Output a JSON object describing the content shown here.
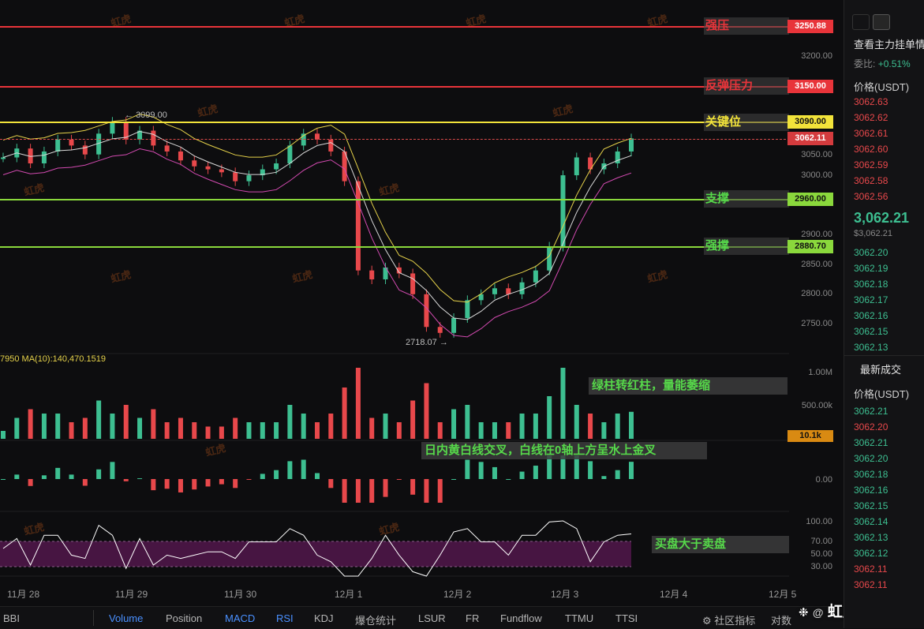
{
  "levels": [
    {
      "label": "强压",
      "price_text": "3250.88",
      "price": 3250.88,
      "color": "#e8343a",
      "text_color": "#e8343a"
    },
    {
      "label": "反弹压力",
      "price_text": "3150.00",
      "price": 3150.0,
      "color": "#e8343a",
      "text_color": "#e8343a"
    },
    {
      "label": "关键位",
      "price_text": "3090.00",
      "price": 3090.0,
      "color": "#f2e33a",
      "text_color": "#f2e33a"
    },
    {
      "label": "支撑",
      "price_text": "2960.00",
      "price": 2960.0,
      "color": "#8ad83c",
      "text_color": "#56d84a"
    },
    {
      "label": "强撑",
      "price_text": "2880.70",
      "price": 2880.7,
      "color": "#8ad83c",
      "text_color": "#56d84a"
    }
  ],
  "current_price_tag": "3062.11",
  "price_axis": [
    "3200.00",
    "3050.00",
    "3000.00",
    "2900.00",
    "2850.00",
    "2800.00",
    "2750.00"
  ],
  "high_marker": "3099.00",
  "low_marker": "2718.07",
  "volume_indicator_text": "7950  MA(10):140,470.1519",
  "volume_axis": [
    "1.00M",
    "500.00k"
  ],
  "volume_tag": "10.1k",
  "macd_axis": "0.00",
  "rsi_axis": [
    "100.00",
    "70.00",
    "50.00",
    "30.00"
  ],
  "annotations": {
    "volume": "绿柱转红柱，量能萎缩",
    "macd": "日内黄白线交叉，白线在0轴上方呈水上金叉",
    "rsi": "买盘大于卖盘"
  },
  "dates": [
    "11月 28",
    "11月 29",
    "11月 30",
    "12月 1",
    "12月 2",
    "12月 3",
    "12月 4",
    "12月 5"
  ],
  "watermark": "虹虎",
  "tabs": {
    "left": "BBI",
    "items": [
      "Volume",
      "Position",
      "MACD",
      "RSI",
      "KDJ",
      "爆仓统计",
      "LSUR",
      "FR",
      "Fundflow",
      "TTMU",
      "TTSI"
    ],
    "active": [
      "Volume",
      "MACD",
      "RSI"
    ],
    "community": "社区指标",
    "compare": "对数",
    "brand": "虹虎趋势"
  },
  "side": {
    "header": "查看主力挂单情",
    "ratio_label": "委比:",
    "ratio_value": "+0.51%",
    "price_header": "价格(USDT)",
    "asks": [
      "3062.63",
      "3062.62",
      "3062.61",
      "3062.60",
      "3062.59",
      "3062.58",
      "3062.56"
    ],
    "last_price": "3,062.21",
    "last_usd": "$3,062.21",
    "bids": [
      "3062.20",
      "3062.19",
      "3062.18",
      "3062.17",
      "3062.16",
      "3062.15",
      "3062.13"
    ],
    "trades_title": "最新成交",
    "trades_header": "价格(USDT)",
    "trades": [
      {
        "p": "3062.21",
        "c": "green"
      },
      {
        "p": "3062.20",
        "c": "red"
      },
      {
        "p": "3062.21",
        "c": "green"
      },
      {
        "p": "3062.20",
        "c": "green"
      },
      {
        "p": "3062.18",
        "c": "green"
      },
      {
        "p": "3062.16",
        "c": "green"
      },
      {
        "p": "3062.15",
        "c": "green"
      },
      {
        "p": "3062.14",
        "c": "green"
      },
      {
        "p": "3062.13",
        "c": "green"
      },
      {
        "p": "3062.12",
        "c": "green"
      },
      {
        "p": "3062.11",
        "c": "red"
      },
      {
        "p": "3062.11",
        "c": "red"
      }
    ]
  },
  "colors": {
    "up": "#3dbf91",
    "down": "#e8484b",
    "bg": "#0d0d0f"
  },
  "chart_data": {
    "type": "line",
    "y_range": [
      2700,
      3270
    ],
    "close": [
      3030,
      3045,
      3020,
      3040,
      3060,
      3050,
      3035,
      3070,
      3090,
      3060,
      3075,
      3050,
      3040,
      3025,
      3015,
      3010,
      3005,
      2990,
      3000,
      3010,
      3020,
      3050,
      3070,
      3060,
      3040,
      2990,
      2840,
      2825,
      2845,
      2835,
      2800,
      2745,
      2735,
      2760,
      2790,
      2800,
      2810,
      2800,
      2820,
      2840,
      2880,
      3000,
      3030,
      3010,
      3020,
      3040,
      3062
    ]
  }
}
